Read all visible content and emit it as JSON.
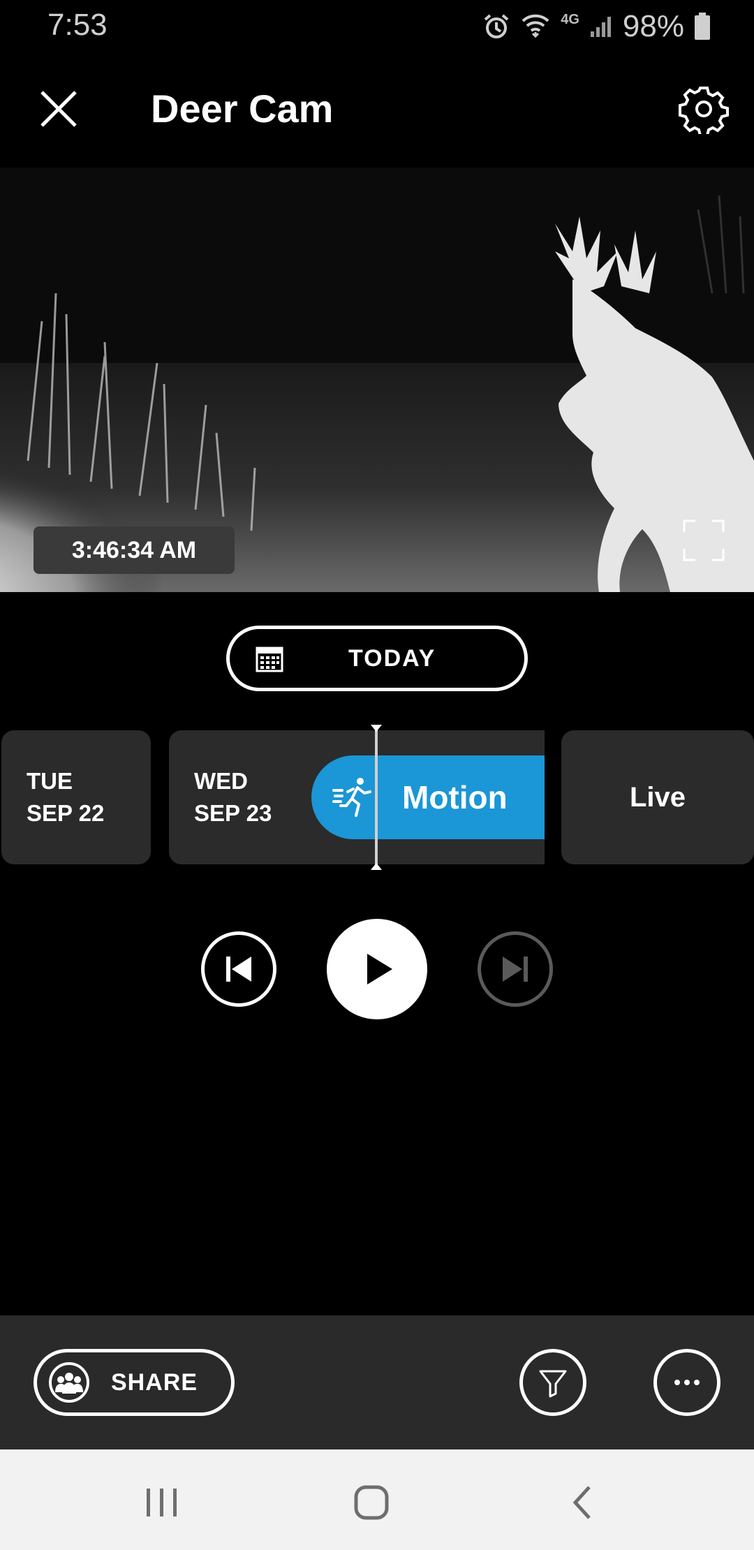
{
  "status_bar": {
    "time": "7:53",
    "network": "4G",
    "battery_percent": "98%"
  },
  "header": {
    "title": "Deer Cam",
    "close_icon": "close-icon",
    "settings_icon": "gear-icon"
  },
  "video": {
    "timestamp": "3:46:34 AM"
  },
  "date_picker": {
    "label": "TODAY",
    "icon": "calendar-icon"
  },
  "timeline": {
    "days": [
      {
        "weekday": "TUE",
        "date": "SEP 22"
      },
      {
        "weekday": "WED",
        "date": "SEP 23"
      }
    ],
    "event": {
      "label": "Motion",
      "icon": "running-person-icon",
      "color": "#1b96d6"
    },
    "live_label": "Live"
  },
  "playback": {
    "prev_icon": "skip-previous-icon",
    "play_icon": "play-icon",
    "next_icon": "skip-next-icon"
  },
  "bottom_bar": {
    "share_label": "SHARE",
    "share_icon": "neighbors-icon",
    "filter_icon": "filter-icon",
    "more_icon": "more-icon"
  },
  "colors": {
    "accent": "#1b96d6",
    "card": "#2b2b2b",
    "background": "#000000"
  }
}
